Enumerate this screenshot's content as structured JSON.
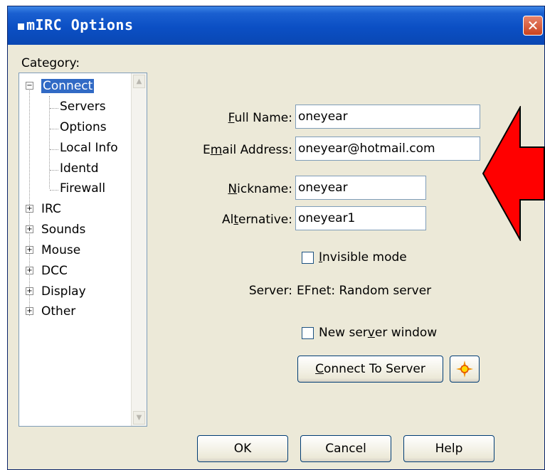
{
  "window": {
    "title": "mIRC Options",
    "close_label": "✕"
  },
  "category": {
    "label": "Category:",
    "tree": [
      {
        "label": "Connect",
        "expander": "−",
        "selected": true
      },
      {
        "label": "Servers"
      },
      {
        "label": "Options"
      },
      {
        "label": "Local Info"
      },
      {
        "label": "Identd"
      },
      {
        "label": "Firewall"
      },
      {
        "label": "IRC",
        "expander": "+"
      },
      {
        "label": "Sounds",
        "expander": "+"
      },
      {
        "label": "Mouse",
        "expander": "+"
      },
      {
        "label": "DCC",
        "expander": "+"
      },
      {
        "label": "Display",
        "expander": "+"
      },
      {
        "label": "Other",
        "expander": "+"
      }
    ]
  },
  "form": {
    "full_name": {
      "label_pre": "",
      "label_key": "F",
      "label_post": "ull Name:",
      "value": "oneyear"
    },
    "email": {
      "label_pre": "E",
      "label_key": "m",
      "label_post": "ail Address:",
      "value": "oneyear@hotmail.com"
    },
    "nickname": {
      "label_pre": "",
      "label_key": "N",
      "label_post": "ickname:",
      "value": "oneyear"
    },
    "alternative": {
      "label_pre": "Al",
      "label_key": "t",
      "label_post": "ernative:",
      "value": "oneyear1"
    },
    "invisible": {
      "label_pre": "",
      "label_key": "I",
      "label_post": "nvisible mode",
      "checked": false
    },
    "server_label": "Server:",
    "server_value": "EFnet: Random server",
    "new_server_window": {
      "label_pre": "New ser",
      "label_key": "v",
      "label_post": "er window",
      "checked": false
    },
    "connect_button": {
      "label_pre": "",
      "label_key": "C",
      "label_post": "onnect To Server"
    }
  },
  "buttons": {
    "ok": "OK",
    "cancel": "Cancel",
    "help": "Help"
  },
  "colors": {
    "selection": "#316ac5",
    "arrow": "#ff0000",
    "titlebar": "#0b4fc4"
  }
}
